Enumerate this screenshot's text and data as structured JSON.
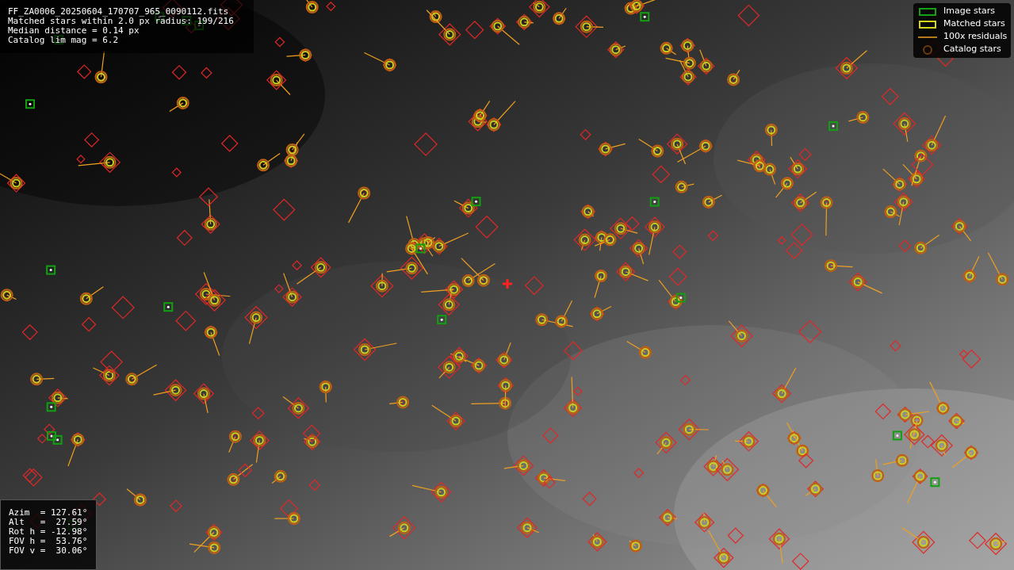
{
  "file_info": {
    "lines": [
      "FF_ZA0006_20250604_170707_965_0090112.fits",
      "Matched stars within 2.0 px radius: 199/216",
      "Median distance = 0.14 px",
      "Catalog lim mag = 6.2"
    ]
  },
  "legend": {
    "items": [
      {
        "label": "Image stars"
      },
      {
        "kind": "matched",
        "label": "Matched stars"
      },
      {
        "kind": "residual",
        "label": "100x residuals"
      },
      {
        "kind": "catalog",
        "label": "Catalog stars"
      }
    ]
  },
  "pointing": {
    "lines": [
      "Azim  = 127.61°",
      "Alt   =  27.59°",
      "Rot h = -12.98°",
      "FOV h =  53.76°",
      "FOV v =  30.06°"
    ]
  }
}
